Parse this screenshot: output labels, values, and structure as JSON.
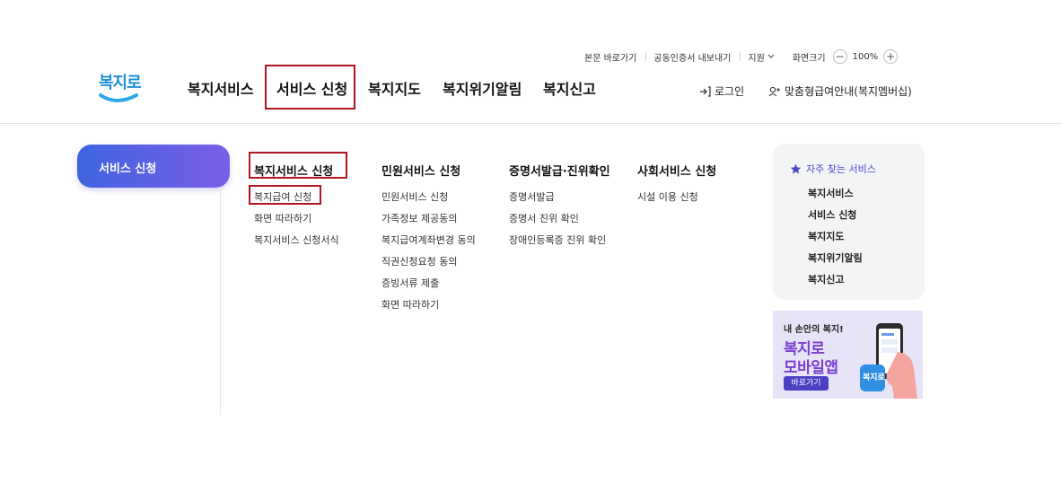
{
  "utility": {
    "skip_link": "본문 바로가기",
    "cert_export": "공동인증서 내보내기",
    "support": "지원",
    "zoom_label": "화면크기",
    "zoom_minus": "−",
    "zoom_value": "100%",
    "zoom_plus": "+"
  },
  "logo": {
    "text": "복지로"
  },
  "gnb": {
    "items": [
      "복지서비스",
      "서비스 신청",
      "복지지도",
      "복지위기알림",
      "복지신고"
    ]
  },
  "header_right": {
    "login": "로그인",
    "membership": "맞춤형급여안내(복지멤버십)"
  },
  "side_tab": {
    "label": "서비스 신청"
  },
  "menu": {
    "columns": [
      {
        "title": "복지서비스 신청",
        "items": [
          "복지급여 신청",
          "화면 따라하기",
          "복지서비스 신청서식"
        ]
      },
      {
        "title": "민원서비스 신청",
        "items": [
          "민원서비스 신청",
          "가족정보 제공동의",
          "복지급여계좌변경 동의",
          "직권신청요청 동의",
          "증빙서류 제출",
          "화면 따라하기"
        ]
      },
      {
        "title": "증명서발급·진위확인",
        "items": [
          "증명서발급",
          "증명서 진위 확인",
          "장애인등록증 진위 확인"
        ]
      },
      {
        "title": "사회서비스 신청",
        "items": [
          "시설 이용 신청"
        ]
      }
    ]
  },
  "favorites": {
    "title": "자주 찾는 서비스",
    "items": [
      "복지서비스",
      "서비스 신청",
      "복지지도",
      "복지위기알림",
      "복지신고"
    ]
  },
  "banner": {
    "small": "내 손안의 복지!",
    "line1": "복지로",
    "line2": "모바일앱",
    "button": "바로가기",
    "phone_badge": "복지로"
  },
  "colors": {
    "accent_red": "#b0161d",
    "pill_start": "#3f64e0",
    "pill_end": "#7a5ee6",
    "banner_purple": "#7a3fd1"
  }
}
